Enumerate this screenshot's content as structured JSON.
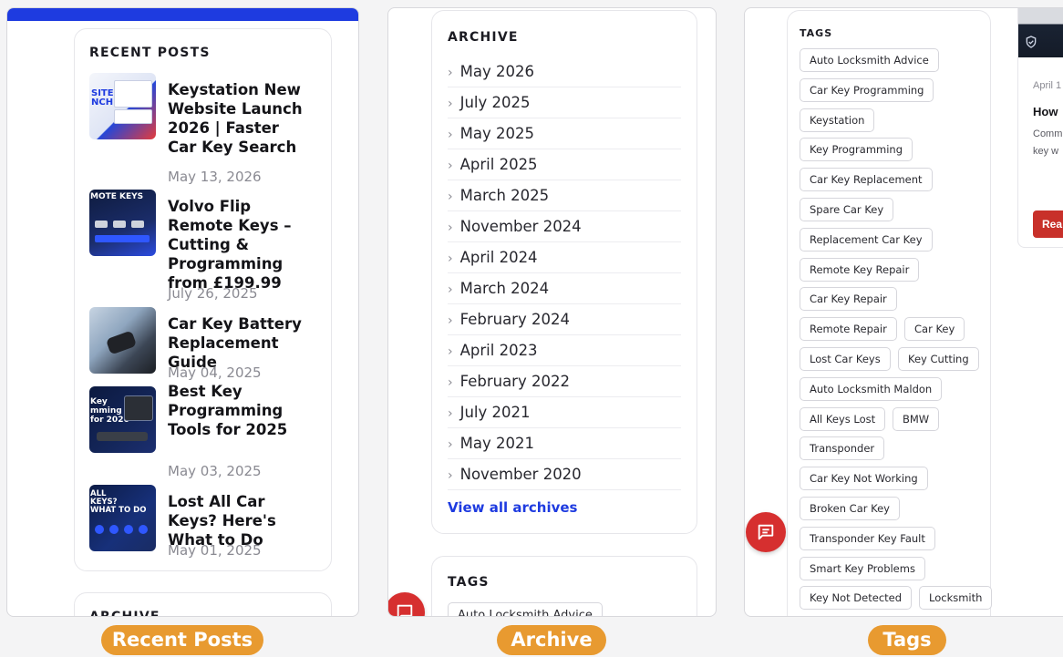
{
  "recent": {
    "heading": "RECENT POSTS",
    "posts": [
      {
        "title": "Keystation New Website Launch 2026 | Faster Car Key Search",
        "date": "May 13, 2026",
        "thumb_text": "SITE\nNCH"
      },
      {
        "title": "Volvo Flip Remote Keys – Cutting & Programming from £199.99",
        "date": "July 26, 2025",
        "thumb_text": "MOTE KEYS"
      },
      {
        "title": "Car Key Battery Replacement Guide",
        "date": "May 04, 2025",
        "thumb_text": ""
      },
      {
        "title": "Best Key Programming Tools for 2025",
        "date": "May 03, 2025",
        "thumb_text": "Key\nmming\nfor 2026"
      },
      {
        "title": "Lost All Car Keys? Here's What to Do",
        "date": "May 01, 2025",
        "thumb_text": "ALL\nKEYS?\nWHAT TO DO"
      }
    ],
    "next_heading": "ARCHIVE"
  },
  "archive": {
    "heading": "ARCHIVE",
    "items": [
      "May 2026",
      "July 2025",
      "May 2025",
      "April 2025",
      "March 2025",
      "November 2024",
      "April 2024",
      "March 2024",
      "February 2024",
      "April 2023",
      "February 2022",
      "July 2021",
      "May 2021",
      "November 2020"
    ],
    "view_all": "View all archives",
    "tags_heading": "TAGS",
    "tags_first": "Auto Locksmith Advice"
  },
  "tags": {
    "heading": "TAGS",
    "rows": [
      [
        "Auto Locksmith Advice"
      ],
      [
        "Car Key Programming"
      ],
      [
        "Keystation"
      ],
      [
        "Key Programming"
      ],
      [
        "Car Key Replacement"
      ],
      [
        "Spare Car Key"
      ],
      [
        "Replacement Car Key"
      ],
      [
        "Remote Key Repair"
      ],
      [
        "Car Key Repair"
      ],
      [
        "Remote Repair",
        "Car Key"
      ],
      [
        "Lost Car Keys",
        "Key Cutting"
      ],
      [
        "Auto Locksmith Maldon"
      ],
      [
        "All Keys Lost",
        "BMW"
      ],
      [
        "Transponder"
      ],
      [
        "Car Key Not Working"
      ],
      [
        "Broken Car Key"
      ],
      [
        "Transponder Key Fault"
      ],
      [
        "Smart Key Problems"
      ],
      [
        "Key Not Detected",
        "Locksmith"
      ]
    ]
  },
  "side_card": {
    "date": "April 1",
    "title": "How",
    "excerpt_1": "Comm",
    "excerpt_2": "key w",
    "button": "Rea"
  },
  "labels": {
    "recent": "Recent Posts",
    "archive": "Archive",
    "tags": "Tags"
  },
  "colors": {
    "accent_blue": "#1e3be0",
    "pill_orange": "#e89a30",
    "chat_red": "#d62f2f"
  }
}
